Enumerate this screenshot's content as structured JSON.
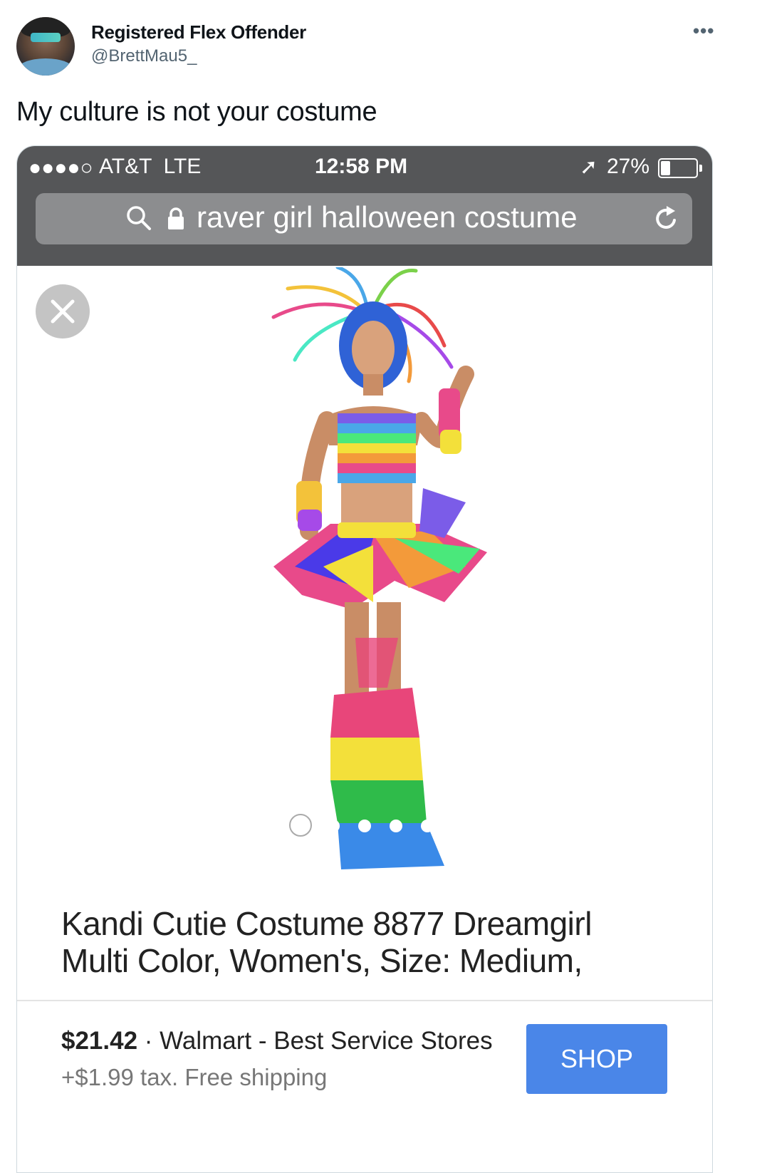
{
  "tweet": {
    "display_name": "Registered Flex Offender",
    "handle": "@BrettMau5_",
    "more_icon": "more-horizontal-icon",
    "more_glyph": "•••",
    "text": "My culture is not your costume"
  },
  "phone": {
    "status_bar": {
      "signal": "●●●●○",
      "carrier": "AT&T  LTE",
      "time": "12:58 PM",
      "location_glyph": "➚",
      "battery_percent_text": "27%",
      "battery_level": 0.27
    },
    "url_bar": {
      "query": "raver girl halloween costume",
      "search_icon": "search-icon",
      "lock_icon": "lock-icon",
      "reload_icon": "reload-icon"
    },
    "product": {
      "close_icon": "close-icon",
      "carousel_total": 5,
      "carousel_active": 1,
      "title_line1": "Kandi Cutie Costume 8877 Dreamgirl",
      "title_line2": "Multi Color, Women's, Size: Medium,",
      "price": "$21.42",
      "seller": "· Walmart - Best Service Stores",
      "tax_shipping": "+$1.99 tax. Free shipping",
      "shop_label": "SHOP"
    }
  },
  "colors": {
    "status_bar_bg": "#555658",
    "url_field_bg": "#8c8d8f",
    "shop_button": "#4a86e8",
    "handle_gray": "#536471"
  }
}
